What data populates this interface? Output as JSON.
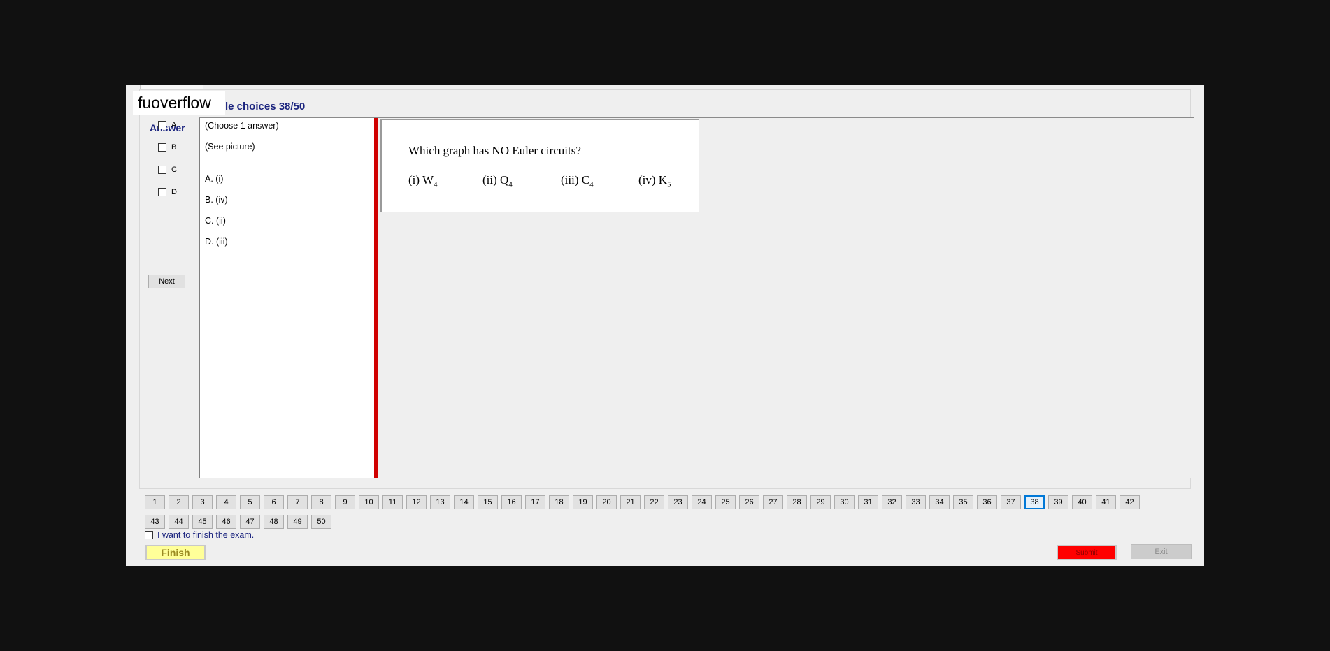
{
  "watermark": "fuoverflow",
  "title": "le choices 38/50",
  "answer_panel": {
    "heading": "Answer",
    "options": [
      "A",
      "B",
      "C",
      "D"
    ],
    "next_label": "Next"
  },
  "question_list": {
    "instruction": "(Choose 1 answer)",
    "see_picture": "(See picture)",
    "answers": [
      "A.  (i)",
      "B.  (iv)",
      "C.  (ii)",
      "D.  (iii)"
    ]
  },
  "question_image": {
    "text": "Which graph has  NO Euler circuits?",
    "choices": [
      {
        "prefix": "(i)  W",
        "sub": "4"
      },
      {
        "prefix": "(ii)  Q",
        "sub": "4"
      },
      {
        "prefix": "(iii)  C",
        "sub": "4"
      },
      {
        "prefix": "(iv)  K",
        "sub": "5"
      }
    ]
  },
  "navigation": {
    "total": 50,
    "current": 38,
    "per_row": 42
  },
  "finish_checkbox_label": "I want to finish the exam.",
  "finish_label": "Finish",
  "submit_label": "Submit",
  "exit_label": "Exit",
  "colors": {
    "accent_text": "#1a237e",
    "splitter": "#d00000",
    "finish_bg": "#ffff99",
    "submit_bg": "#ff0000",
    "current_question_border": "#0078d7"
  }
}
